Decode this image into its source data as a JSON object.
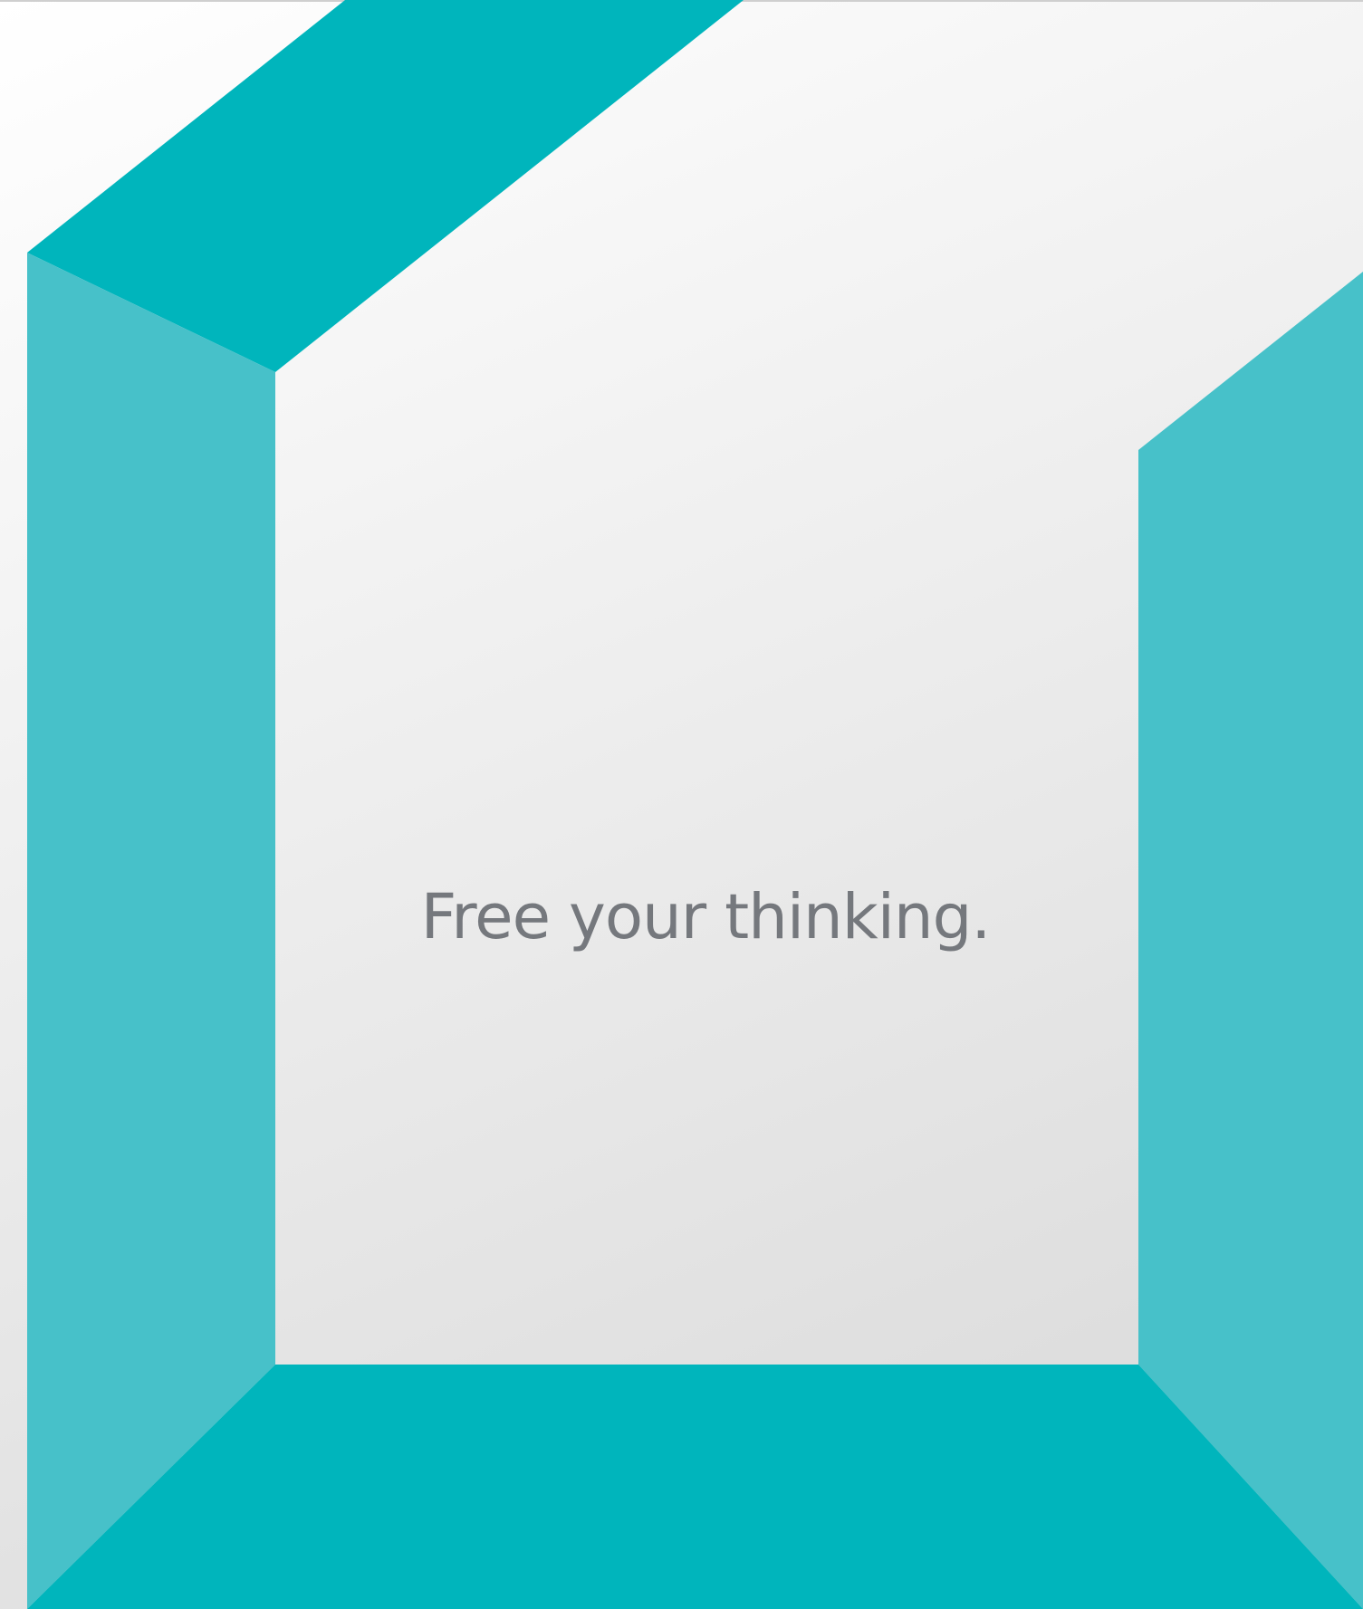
{
  "poster": {
    "tagline": "Free your thinking."
  },
  "colors": {
    "teal_dark": "#00b5bc",
    "teal_light": "#47c1c9",
    "background_light": "#ffffff",
    "background_gray": "#e2e2e2",
    "tagline_text": "#75787d"
  }
}
